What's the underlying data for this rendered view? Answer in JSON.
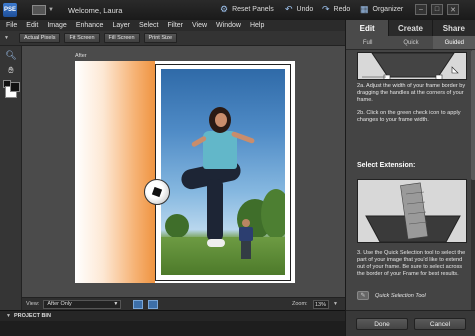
{
  "titlebar": {
    "app_badge": "PSE",
    "welcome": "Welcome, Laura",
    "reset_panels": "Reset Panels",
    "undo": "Undo",
    "redo": "Redo",
    "organizer": "Organizer",
    "minimize": "–",
    "maximize": "□",
    "close": "✕"
  },
  "menu": [
    "File",
    "Edit",
    "Image",
    "Enhance",
    "Layer",
    "Select",
    "Filter",
    "View",
    "Window",
    "Help"
  ],
  "options": [
    "Actual Pixels",
    "Fit Screen",
    "Fill Screen",
    "Print Size"
  ],
  "canvas": {
    "after_label": "After"
  },
  "status": {
    "view_label": "View:",
    "view_value": "After Only",
    "zoom_label": "Zoom:",
    "zoom_value": "13%"
  },
  "project_bin": {
    "label": "PROJECT BIN"
  },
  "panel": {
    "mode_tabs": [
      "Edit",
      "Create",
      "Share"
    ],
    "active_mode": "Edit",
    "sub_tabs": [
      "Full",
      "Quick",
      "Guided"
    ],
    "active_sub": "Guided",
    "step_2a": "2a. Adjust the width of your frame border by dragging the handles at the corners of your frame.",
    "step_2b": "2b. Click on the green check icon to apply changes to your frame width.",
    "section_title": "Select Extension:",
    "step_3": "3. Use the Quick Selection tool to select the part of your image that you'd like to extend out of your frame. Be sure to select across the border of your Frame for best results.",
    "tool_label": "Quick Selection Tool",
    "done": "Done",
    "cancel": "Cancel"
  },
  "colors": {
    "accent": "#3d7bd0",
    "glow": "#ef9441",
    "panel_bg": "#444444"
  }
}
